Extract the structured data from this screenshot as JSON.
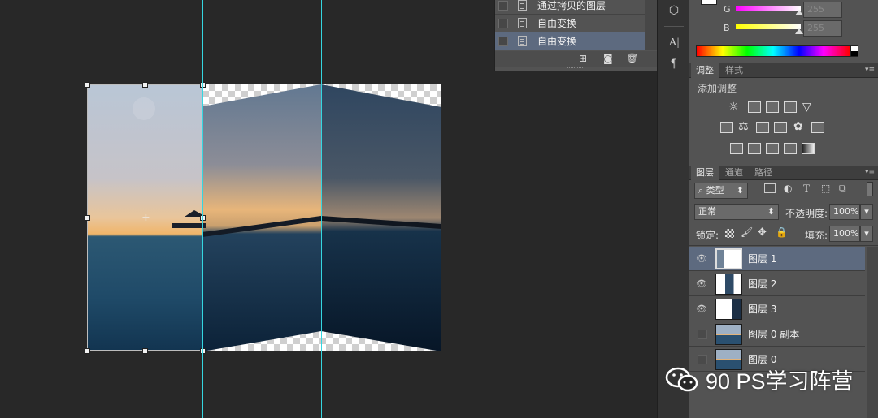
{
  "history": {
    "items": [
      {
        "label": "通过拷贝的图层",
        "selected": false
      },
      {
        "label": "自由变换",
        "selected": false
      },
      {
        "label": "自由变换",
        "selected": true
      }
    ]
  },
  "color_panel": {
    "channels": [
      {
        "label": "G",
        "value": "255"
      },
      {
        "label": "B",
        "value": "255"
      }
    ]
  },
  "adjustments_panel": {
    "tabs": [
      "调整",
      "样式"
    ],
    "active_tab": "调整",
    "heading": "添加调整"
  },
  "layers_panel": {
    "tabs": [
      "图层",
      "通道",
      "路径"
    ],
    "active_tab": "图层",
    "filter_kind": "类型",
    "blend_mode": "正常",
    "opacity_label": "不透明度:",
    "opacity_value": "100%",
    "lock_label": "锁定:",
    "fill_label": "填充:",
    "fill_value": "100%",
    "layers": [
      {
        "name": "图层 1",
        "visible": true,
        "selected": true
      },
      {
        "name": "图层 2",
        "visible": true,
        "selected": false
      },
      {
        "name": "图层 3",
        "visible": true,
        "selected": false
      },
      {
        "name": "图层 0 副本",
        "visible": false,
        "selected": false
      },
      {
        "name": "图层 0",
        "visible": false,
        "selected": false
      }
    ]
  },
  "watermark": {
    "text": "90 PS学习阵营"
  },
  "colors": {
    "guide": "#35d6e0",
    "selection": "#5d6a7f",
    "panel": "#535353",
    "canvas_bg": "#282828"
  }
}
